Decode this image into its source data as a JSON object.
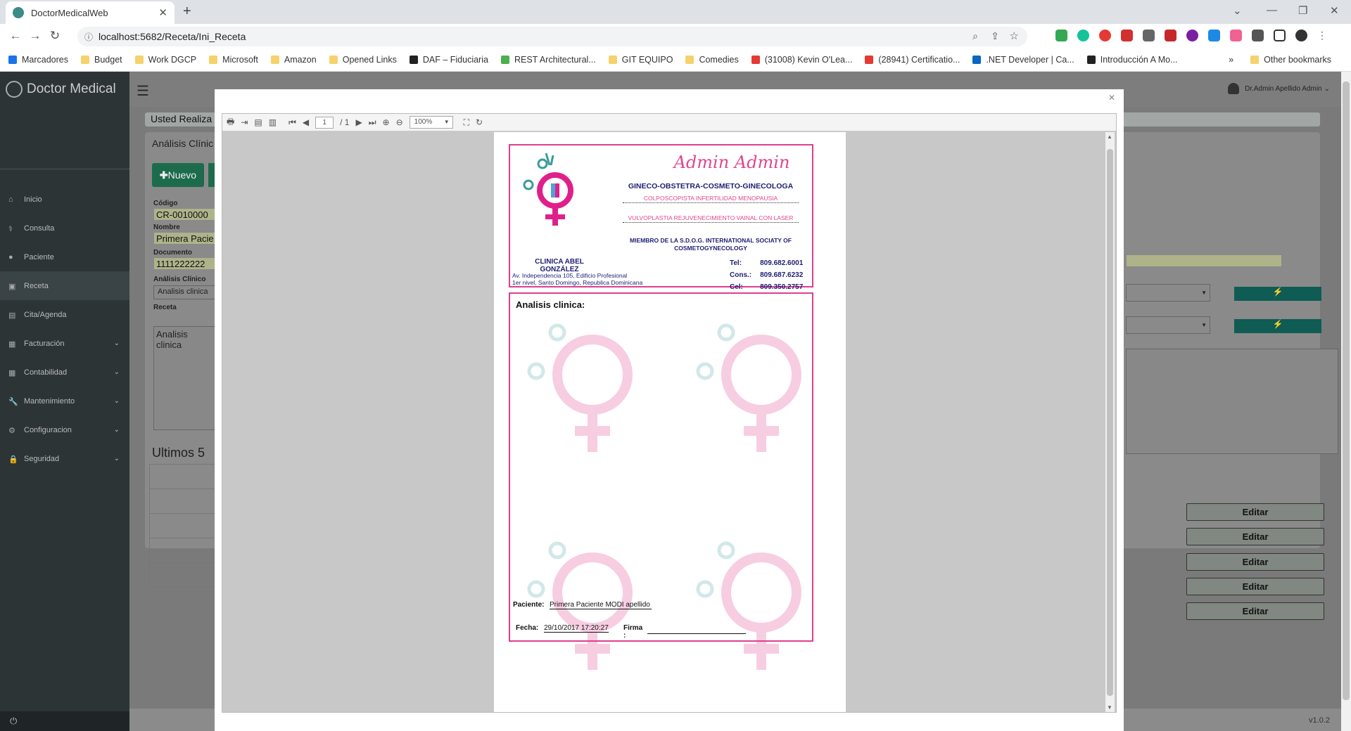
{
  "browser": {
    "tab_title": "DoctorMedicalWeb",
    "url": "localhost:5682/Receta/Ini_Receta",
    "bookmarks": [
      {
        "label": "Marcadores",
        "kind": "b"
      },
      {
        "label": "Budget",
        "kind": ""
      },
      {
        "label": "Work DGCP",
        "kind": ""
      },
      {
        "label": "Microsoft",
        "kind": ""
      },
      {
        "label": "Amazon",
        "kind": ""
      },
      {
        "label": "Opened Links",
        "kind": ""
      },
      {
        "label": "DAF – Fiduciaria",
        "kind": "k"
      },
      {
        "label": "REST Architectural...",
        "kind": "g"
      },
      {
        "label": "GIT EQUIPO",
        "kind": ""
      },
      {
        "label": "Comedies",
        "kind": ""
      },
      {
        "label": "(31008) Kevin O'Lea...",
        "kind": "r"
      },
      {
        "label": "(28941) Certificatio...",
        "kind": "r"
      },
      {
        "label": ".NET Developer | Ca...",
        "kind": "l"
      },
      {
        "label": "Introducción A Mo...",
        "kind": "k"
      }
    ],
    "bookmarks_more": "»",
    "other_bookmarks": "Other bookmarks"
  },
  "app": {
    "brand": "Doctor Medical",
    "user": "Dr.Admin Apellido Admin",
    "version": "v1.0.2",
    "menu": [
      {
        "label": "Inicio",
        "icon": "home-icon",
        "chev": false
      },
      {
        "label": "Consulta",
        "icon": "stethoscope-icon",
        "chev": false
      },
      {
        "label": "Paciente",
        "icon": "user-icon",
        "chev": false
      },
      {
        "label": "Receta",
        "icon": "medkit-icon",
        "chev": false
      },
      {
        "label": "Cita/Agenda",
        "icon": "book-icon",
        "chev": false
      },
      {
        "label": "Facturación",
        "icon": "file-icon",
        "chev": true
      },
      {
        "label": "Contabilidad",
        "icon": "table-icon",
        "chev": true
      },
      {
        "label": "Mantenimiento",
        "icon": "wrench-icon",
        "chev": true
      },
      {
        "label": "Configuracion",
        "icon": "gear-icon",
        "chev": true
      },
      {
        "label": "Seguridad",
        "icon": "lock-icon",
        "chev": true
      }
    ],
    "breadcrumb": "Usted Realiza",
    "panel_title": "Análisis Clínic",
    "new_button": "Nuevo",
    "form": {
      "codigo_label": "Código",
      "codigo_value": "CR-0010000",
      "nombre_label": "Nombre",
      "nombre_value": "Primera Pacie",
      "documento_label": "Documento",
      "documento_value": "1111222222",
      "analisis_label": "Análisis Clínico",
      "analisis_value": "Analisis clinica",
      "receta_label": "Receta",
      "receta_value": "Analisis clinica"
    },
    "ultimos_title": "Ultimos 5",
    "edit_label": "Editar"
  },
  "viewer": {
    "page_current": "1",
    "page_total": "/ 1",
    "zoom": "100%"
  },
  "document": {
    "doctor_name": "Admin Admin",
    "specialty": "GINECO-OBSTETRA-COSMETO-GINECOLOGA",
    "line1": "COLPOSCOPISTA  INFERTILIDAD MENOPAUSIA",
    "line2": "VULVOPLASTIA  REJUVENECIMIENTO VAINAL CON LASER",
    "member": "MIEMBRO DE LA S.D.O.G. INTERNATIONAL SOCIATY OF COSMETOGYNECOLOGY",
    "clinic": "CLINICA ABEL GONZÁLEZ",
    "address1": "Av. Independencia 105, Edificio Profesional",
    "address2": "1er nivel, Santo Domingo, Republica Dominicana",
    "tel_label": "Tel:",
    "tel": "809.682.6001",
    "cons_label": "Cons.:",
    "cons": "809.687.6232",
    "cel_label": "Cel:",
    "cel": "809.350.2757",
    "analisis_title": "Analisis clinica:",
    "paciente_label": "Paciente:",
    "paciente": "Primera Paciente MODI apellido",
    "fecha_label": "Fecha:",
    "fecha": "29/10/2017 17:20:27",
    "firma_label": "Firma :"
  }
}
